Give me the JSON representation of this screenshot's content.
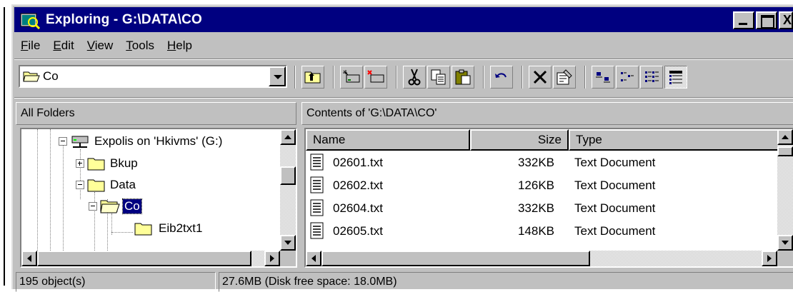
{
  "window": {
    "title": "Exploring - G:\\DATA\\CO"
  },
  "menu": [
    {
      "label_u": "F",
      "label_rest": "ile"
    },
    {
      "label_u": "E",
      "label_rest": "dit"
    },
    {
      "label_u": "V",
      "label_rest": "iew"
    },
    {
      "label_u": "T",
      "label_rest": "ools"
    },
    {
      "label_u": "H",
      "label_rest": "elp"
    }
  ],
  "address": {
    "value": "Co"
  },
  "panes": {
    "left_header": "All Folders",
    "right_header": "Contents of 'G:\\DATA\\CO'"
  },
  "tree": [
    {
      "label": "Expolis on 'Hkivms' (G:)",
      "icon": "network-drive-icon",
      "expander": "minus"
    },
    {
      "label": "Bkup",
      "icon": "folder-icon",
      "expander": "plus"
    },
    {
      "label": "Data",
      "icon": "folder-icon",
      "expander": "minus"
    },
    {
      "label": "Co",
      "icon": "open-folder-icon",
      "expander": "minus",
      "selected": true
    },
    {
      "label": "Eib2txt1",
      "icon": "folder-icon",
      "expander": "none"
    }
  ],
  "columns": {
    "name": "Name",
    "size": "Size",
    "type": "Type"
  },
  "files": [
    {
      "name": "02601.txt",
      "size": "332KB",
      "type": "Text Document"
    },
    {
      "name": "02602.txt",
      "size": "126KB",
      "type": "Text Document"
    },
    {
      "name": "02604.txt",
      "size": "332KB",
      "type": "Text Document"
    },
    {
      "name": "02605.txt",
      "size": "148KB",
      "type": "Text Document"
    }
  ],
  "status": {
    "objects": "195 object(s)",
    "size": "27.6MB (Disk free space: 18.0MB)"
  },
  "colors": {
    "titlebar": "#000080",
    "face": "#c0c0c0",
    "selection": "#000080"
  }
}
